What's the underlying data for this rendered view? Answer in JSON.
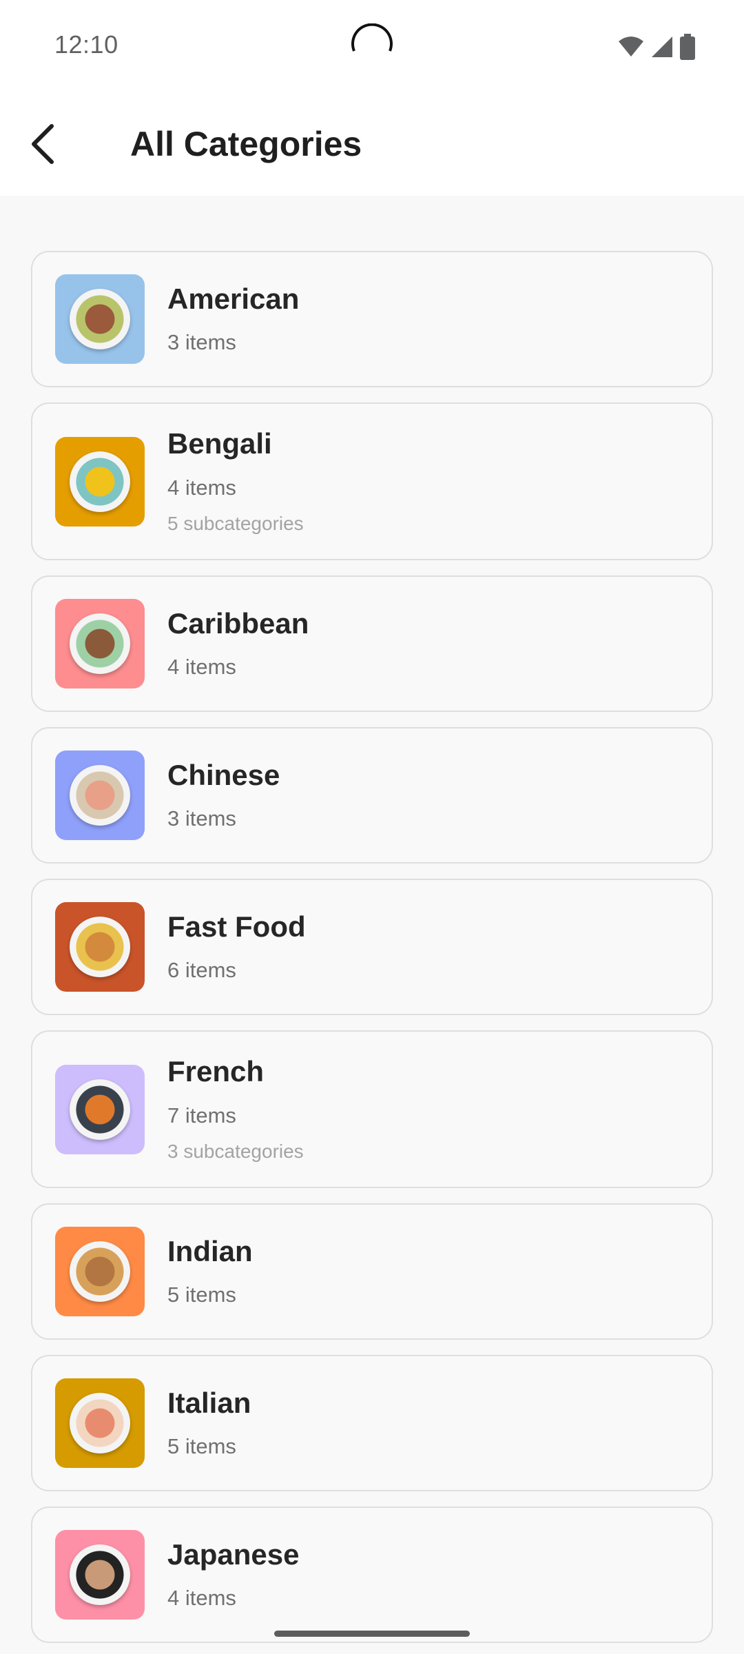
{
  "status_bar": {
    "time": "12:10",
    "icons": [
      "wifi-icon",
      "signal-icon",
      "battery-icon"
    ]
  },
  "app_bar": {
    "back_icon": "arrow-back-icon",
    "title": "All Categories"
  },
  "categories": [
    {
      "name": "American",
      "items": "3 items",
      "subcategories": "",
      "thumb_color": "#97c3ea",
      "food_colors": [
        "#9b5a3c",
        "#b9c46a"
      ]
    },
    {
      "name": "Bengali",
      "items": "4 items",
      "subcategories": "5 subcategories",
      "thumb_color": "#e59e00",
      "food_colors": [
        "#f0c21c",
        "#7ec4c3"
      ]
    },
    {
      "name": "Caribbean",
      "items": "4 items",
      "subcategories": "",
      "thumb_color": "#fd8d8f",
      "food_colors": [
        "#8a5a3a",
        "#9ed0a6"
      ]
    },
    {
      "name": "Chinese",
      "items": "3 items",
      "subcategories": "",
      "thumb_color": "#8fa0fa",
      "food_colors": [
        "#e8a088",
        "#d9c8b0"
      ]
    },
    {
      "name": "Fast Food",
      "items": "6 items",
      "subcategories": "",
      "thumb_color": "#c9542a",
      "food_colors": [
        "#d48a3c",
        "#e9c24e"
      ]
    },
    {
      "name": "French",
      "items": "7 items",
      "subcategories": "3 subcategories",
      "thumb_color": "#cdbdfd",
      "food_colors": [
        "#e07a2a",
        "#39424c"
      ]
    },
    {
      "name": "Indian",
      "items": "5 items",
      "subcategories": "",
      "thumb_color": "#ff8a45",
      "food_colors": [
        "#b27642",
        "#d8a15a"
      ]
    },
    {
      "name": "Italian",
      "items": "5 items",
      "subcategories": "",
      "thumb_color": "#d59b00",
      "food_colors": [
        "#e88c70",
        "#f3d6c0"
      ]
    },
    {
      "name": "Japanese",
      "items": "4 items",
      "subcategories": "",
      "thumb_color": "#fd90a7",
      "food_colors": [
        "#c99a78",
        "#232323"
      ]
    }
  ]
}
